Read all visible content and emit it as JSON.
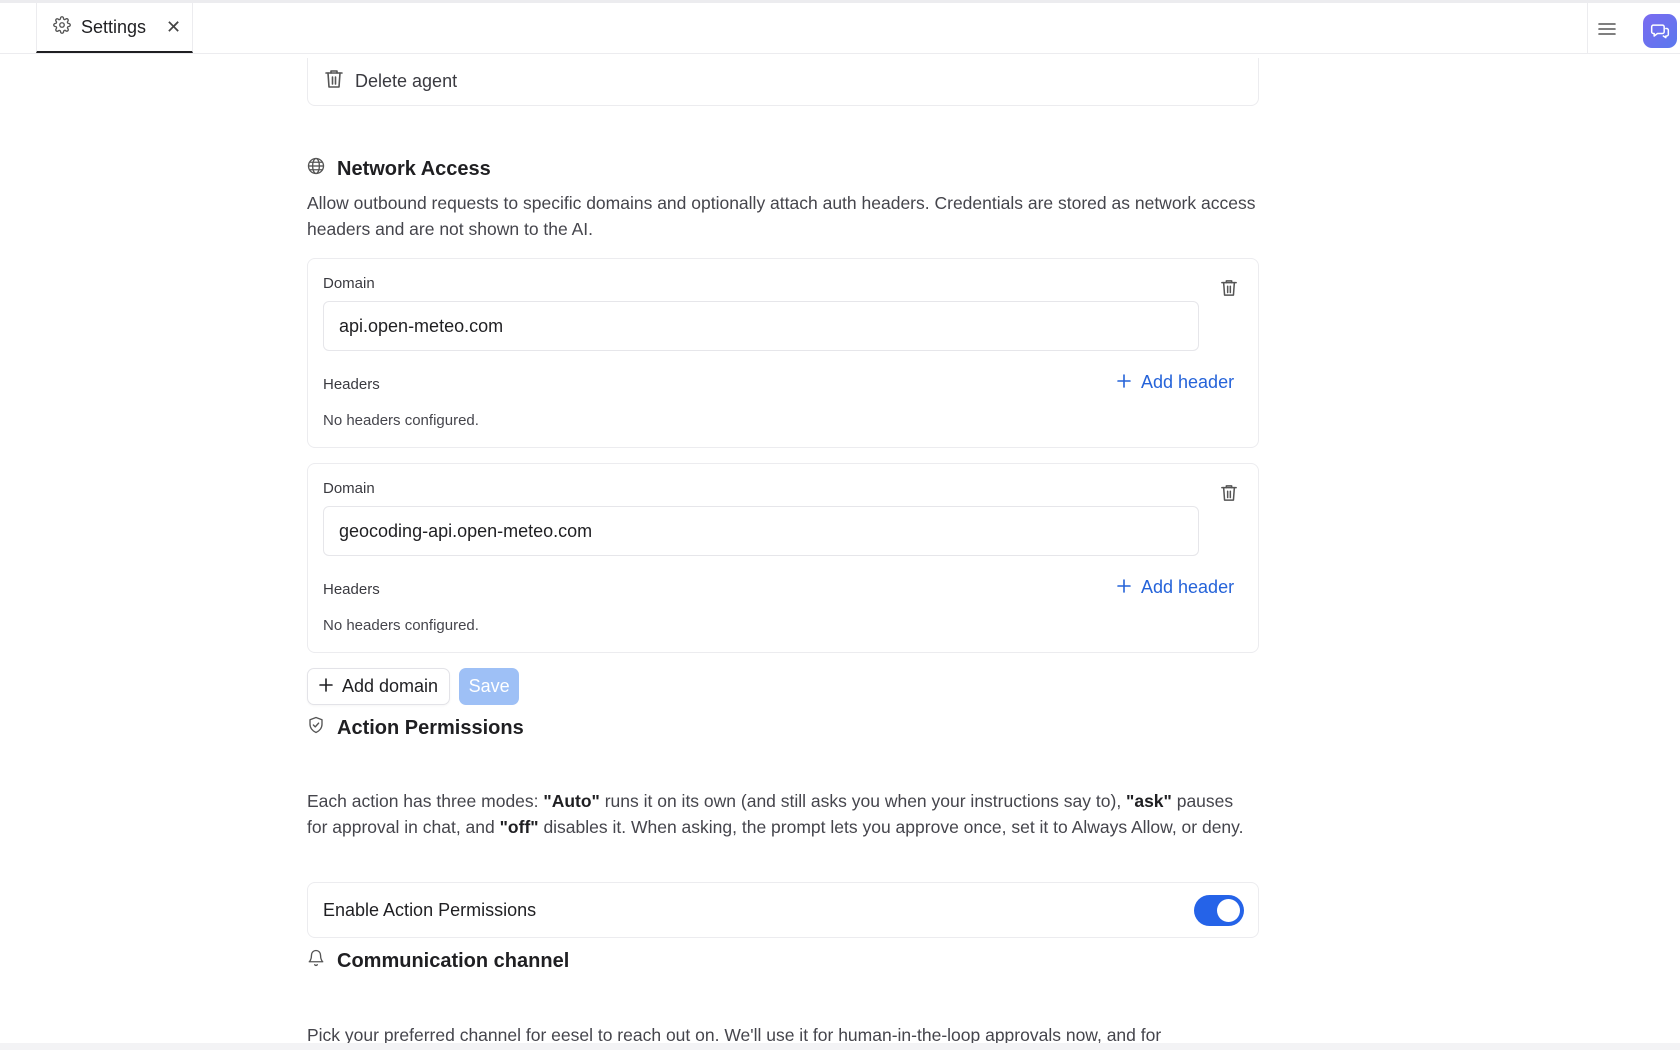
{
  "tab": {
    "label": "Settings"
  },
  "delete_agent": {
    "label": "Delete agent"
  },
  "network_access": {
    "title": "Network Access",
    "description": "Allow outbound requests to specific domains and optionally attach auth headers. Credentials are stored as network access headers and are not shown to the AI.",
    "domains": [
      {
        "label": "Domain",
        "value": "api.open-meteo.com",
        "headers_label": "Headers",
        "add_header": "Add header",
        "empty": "No headers configured."
      },
      {
        "label": "Domain",
        "value": "geocoding-api.open-meteo.com",
        "headers_label": "Headers",
        "add_header": "Add header",
        "empty": "No headers configured."
      }
    ],
    "add_domain": "Add domain",
    "save": "Save"
  },
  "action_permissions": {
    "title": "Action Permissions",
    "desc_1": "Each action has three modes: ",
    "mode_auto": "\"Auto\"",
    "desc_2": " runs it on its own (and still asks you when your instructions say to), ",
    "mode_ask": "\"ask\"",
    "desc_3": " pauses for approval in chat, and ",
    "mode_off": "\"off\"",
    "desc_4": " disables it. When asking, the prompt lets you approve once, set it to Always Allow, or deny.",
    "toggle_label": "Enable Action Permissions",
    "enabled": true
  },
  "communication": {
    "title": "Communication channel",
    "description": "Pick your preferred channel for eesel to reach out on. We'll use it for human-in-the-loop approvals now, and for"
  },
  "colors": {
    "accent": "#2563e8",
    "link": "#2563d9",
    "save_disabled": "#9ec0f6"
  }
}
